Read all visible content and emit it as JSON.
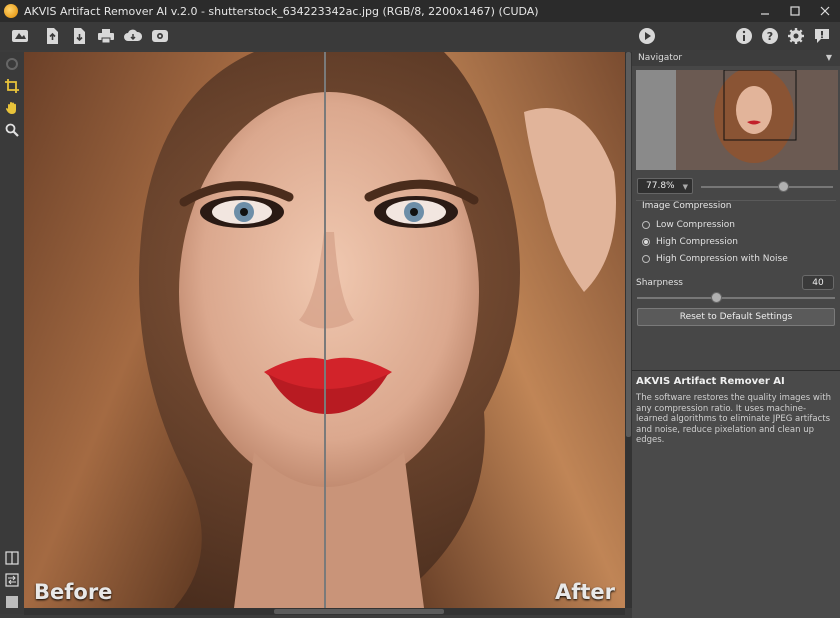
{
  "window": {
    "title": "AKVIS Artifact Remover AI v.2.0 - shutterstock_634223342ac.jpg (RGB/8, 2200x1467) (CUDA)",
    "controls": [
      "minimize",
      "maximize",
      "close"
    ]
  },
  "toolbar": {
    "left_icons": [
      "home-icon",
      "open-file-icon",
      "save-file-icon",
      "print-icon",
      "share-icon",
      "plugins-icon"
    ],
    "run_icon": "play-icon",
    "right_icons": [
      "info-icon",
      "help-icon",
      "settings-icon",
      "notifications-icon"
    ]
  },
  "left_tools": {
    "tools": [
      "disabled-tool-icon",
      "crop-icon",
      "hand-icon",
      "zoom-icon"
    ],
    "bottom_tools": [
      "split-view-icon",
      "swap-view-icon",
      "color-square-icon"
    ]
  },
  "canvas": {
    "before_label": "Before",
    "after_label": "After"
  },
  "navigator": {
    "title": "Navigator",
    "zoom_value": "77.8%",
    "zoom_slider_fraction": 0.62
  },
  "compression": {
    "title": "Image Compression",
    "options": [
      {
        "label": "Low Compression",
        "checked": false
      },
      {
        "label": "High Compression",
        "checked": true
      },
      {
        "label": "High Compression with Noise",
        "checked": false
      }
    ]
  },
  "sharpness": {
    "label": "Sharpness",
    "value": "40",
    "fraction": 0.4
  },
  "reset_button": "Reset to Default Settings",
  "help": {
    "title": "AKVIS Artifact Remover AI",
    "text": "The software restores the quality images with any compression ratio. It uses machine-learned algorithms to eliminate JPEG artifacts and noise, reduce pixelation and clean up edges."
  }
}
